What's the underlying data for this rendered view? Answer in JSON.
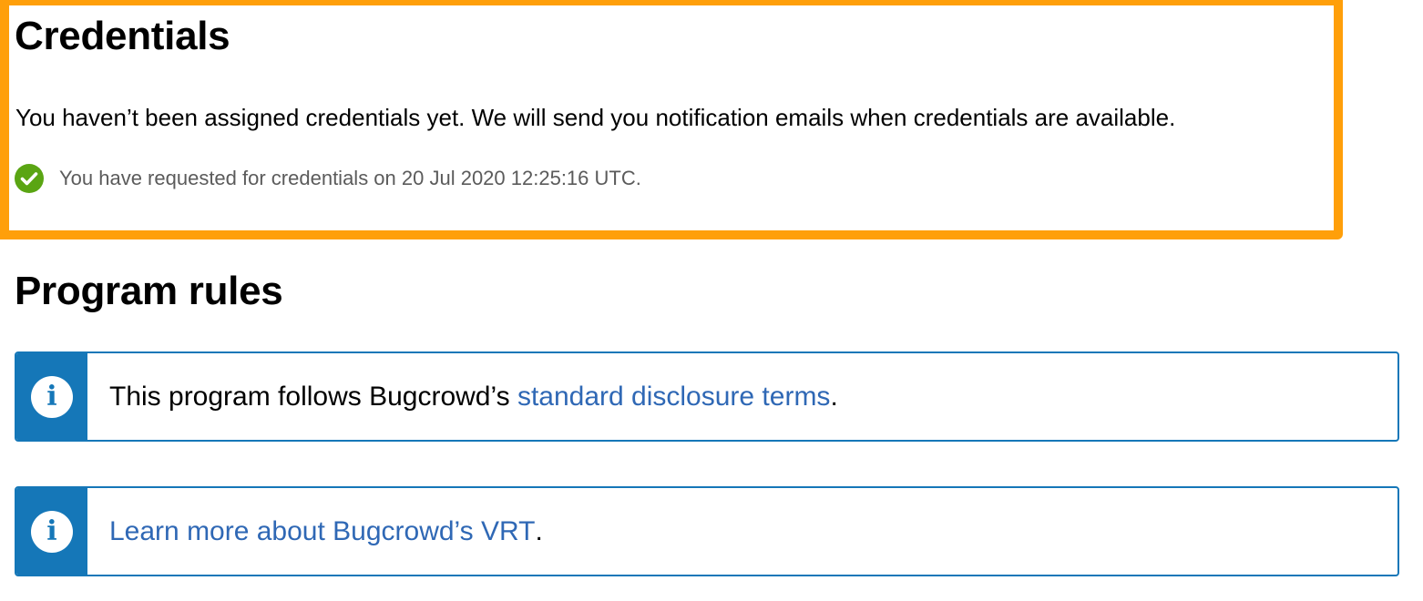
{
  "credentials": {
    "title": "Credentials",
    "message": "You haven’t been assigned credentials yet. We will send you notification emails when credentials are available.",
    "status_icon": "check-circle-icon",
    "status_text": "You have requested for credentials on 20 Jul 2020 12:25:16 UTC.",
    "highlight_color": "#ff9f0a",
    "status_color": "#5aa513"
  },
  "program_rules": {
    "title": "Program rules",
    "notices": [
      {
        "icon": "info-icon",
        "prefix": "This program follows Bugcrowd’s ",
        "link_text": "standard disclosure terms",
        "suffix": "."
      },
      {
        "icon": "info-icon",
        "prefix": "",
        "link_text": "Learn more about Bugcrowd’s VRT",
        "suffix": "."
      }
    ],
    "accent_color": "#1577b8",
    "link_color": "#2f68b5"
  }
}
